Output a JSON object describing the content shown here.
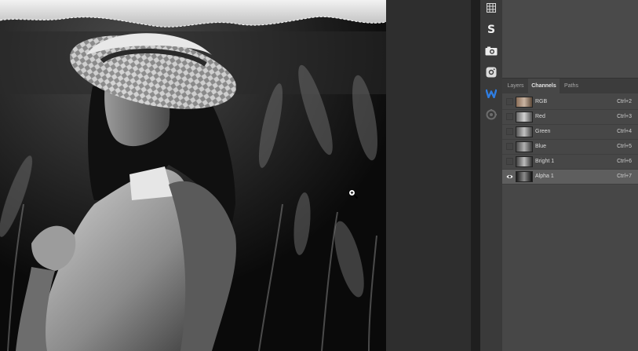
{
  "canvas": {
    "description_icon": "zoom-cursor-icon"
  },
  "toolbar": {
    "icons": [
      "grid-icon",
      "s-logo-icon",
      "camera-icon",
      "instagram-icon",
      "w-logo-icon",
      "puzzle-icon"
    ]
  },
  "panel": {
    "tabs": [
      {
        "label": "Layers",
        "active": false
      },
      {
        "label": "Channels",
        "active": true
      },
      {
        "label": "Paths",
        "active": false
      }
    ],
    "channels": [
      {
        "name": "RGB",
        "shortcut": "Ctrl+2",
        "visible": false,
        "selected": false
      },
      {
        "name": "Red",
        "shortcut": "Ctrl+3",
        "visible": false,
        "selected": false
      },
      {
        "name": "Green",
        "shortcut": "Ctrl+4",
        "visible": false,
        "selected": false
      },
      {
        "name": "Blue",
        "shortcut": "Ctrl+5",
        "visible": false,
        "selected": false
      },
      {
        "name": "Bright 1",
        "shortcut": "Ctrl+6",
        "visible": false,
        "selected": false
      },
      {
        "name": "Alpha 1",
        "shortcut": "Ctrl+7",
        "visible": true,
        "selected": true
      }
    ]
  },
  "colors": {
    "panel_bg": "#474747",
    "selected_row": "#5e5e5e",
    "w_logo_blue": "#2f7de1"
  }
}
